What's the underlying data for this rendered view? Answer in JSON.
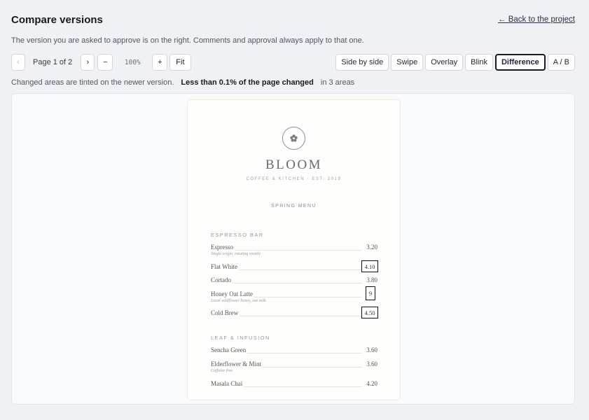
{
  "header": {
    "title": "Compare versions",
    "back_link": "← Back to the project",
    "subtitle": "The version you are asked to approve is on the right. Comments and approval always apply to that one."
  },
  "toolbar": {
    "prev_icon": "‹",
    "next_icon": "›",
    "page_indicator": "Page 1 of 2",
    "zoom_out": "−",
    "zoom_level": "100%",
    "zoom_in": "+",
    "fit": "Fit"
  },
  "modes": [
    {
      "label": "Side by side",
      "active": false
    },
    {
      "label": "Swipe",
      "active": false
    },
    {
      "label": "Overlay",
      "active": false
    },
    {
      "label": "Blink",
      "active": false
    },
    {
      "label": "Difference",
      "active": true
    },
    {
      "label": "A / B",
      "active": false
    }
  ],
  "status": {
    "note": "Changed areas are tinted on the newer version.",
    "summary": "Less than 0.1% of the page changed",
    "areas": "in 3 areas"
  },
  "menu": {
    "logo_icon": "flower-icon",
    "brand": "BLOOM",
    "tagline": "COFFEE & KITCHEN · EST. 2019",
    "menu_name": "SPRING MENU",
    "sections": [
      {
        "title": "ESPRESSO BAR",
        "items": [
          {
            "name": "Espresso",
            "desc": "Single origin, rotating weekly",
            "price": "3.20"
          },
          {
            "name": "Flat White",
            "price": "4.10",
            "changed": true
          },
          {
            "name": "Cortado",
            "price": "3.80"
          },
          {
            "name": "Honey Oat Latte",
            "desc": "Local wildflower honey, oat milk",
            "price": "9",
            "changed": true
          },
          {
            "name": "Cold Brew",
            "price": "4.50",
            "changed": true
          }
        ]
      },
      {
        "title": "LEAF & INFUSION",
        "items": [
          {
            "name": "Sencha Green",
            "price": "3.60"
          },
          {
            "name": "Elderflower & Mint",
            "desc": "Caffeine free",
            "price": "3.60"
          },
          {
            "name": "Masala Chai",
            "price": "4.20"
          }
        ]
      }
    ]
  }
}
